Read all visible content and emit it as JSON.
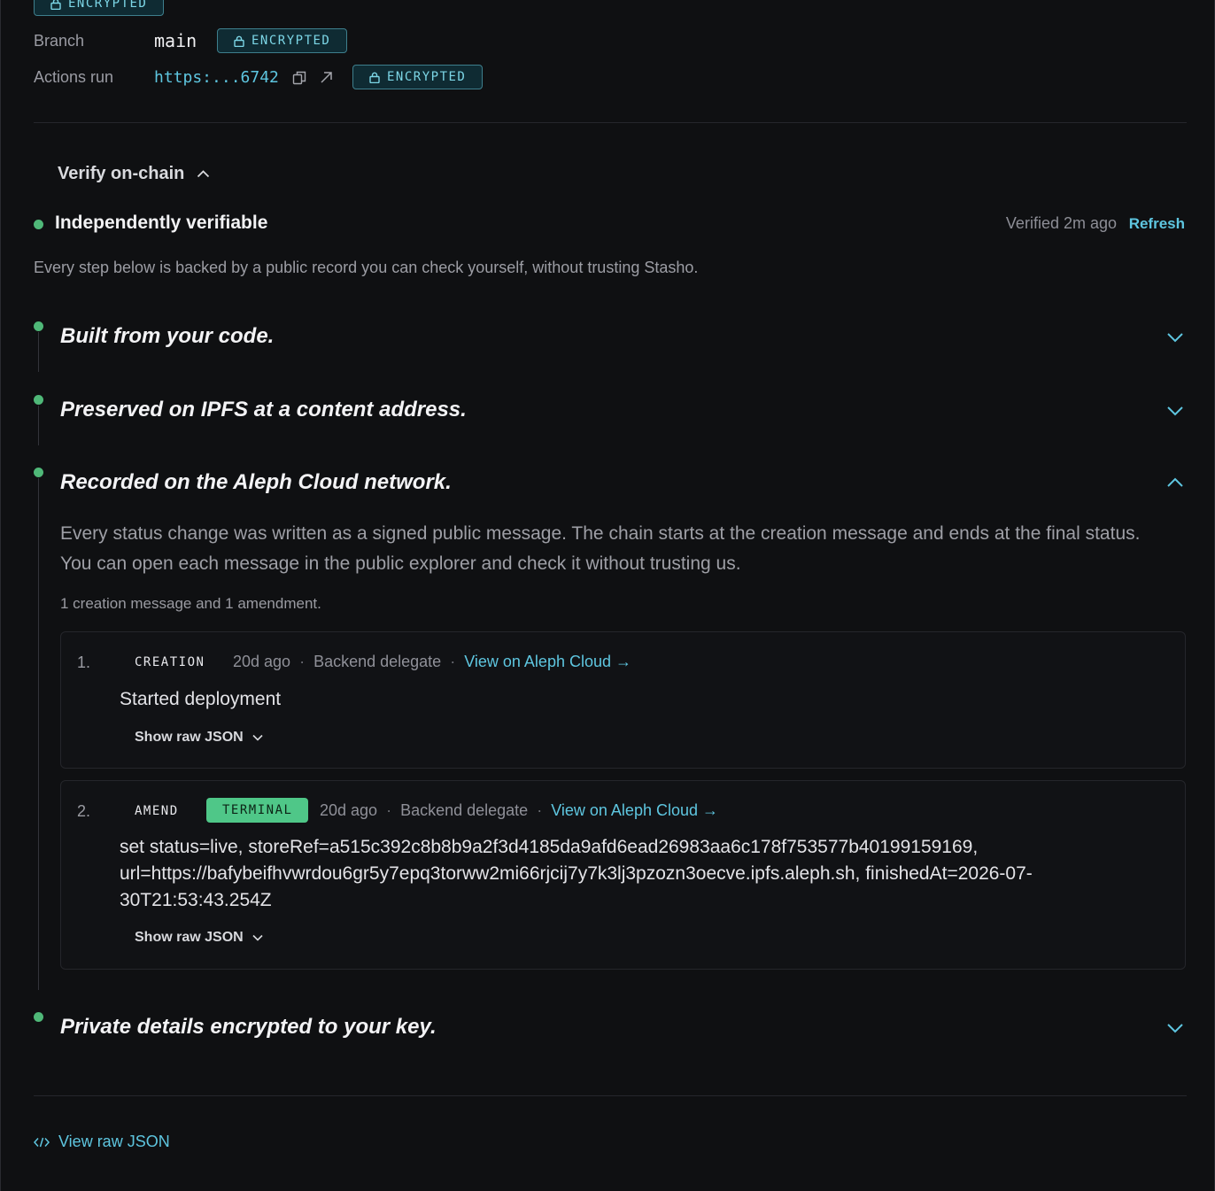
{
  "meta": {
    "encrypted_label": "ENCRYPTED",
    "branch_label": "Branch",
    "branch_value": "main",
    "actions_label": "Actions run",
    "actions_value": "https:...6742"
  },
  "verify": {
    "toggle_label": "Verify on-chain",
    "status_title": "Independently verifiable",
    "verified_ago": "Verified 2m ago",
    "refresh_label": "Refresh",
    "intro": "Every step below is backed by a public record you can check yourself, without trusting Stasho.",
    "steps": [
      {
        "title": "Built from your code."
      },
      {
        "title": "Preserved on IPFS at a content address."
      },
      {
        "title": "Recorded on the Aleph Cloud network.",
        "description": "Every status change was written as a signed public message. The chain starts at the creation message and ends at the final status. You can open each message in the public explorer and check it without trusting us.",
        "count": "1 creation message and 1 amendment.",
        "messages": [
          {
            "num": "1.",
            "kind": "CREATION",
            "age": "20d ago",
            "by": "Backend delegate",
            "link": "View on Aleph Cloud →",
            "body": "Started deployment",
            "raw": "Show raw JSON"
          },
          {
            "num": "2.",
            "kind": "AMEND",
            "badge": "TERMINAL",
            "age": "20d ago",
            "by": "Backend delegate",
            "link": "View on Aleph Cloud →",
            "body": "set status=live, storeRef=a515c392c8b8b9a2f3d4185da9afd6ead26983aa6c178f753577b40199159169, url=https://bafybeifhvwrdou6gr5y7epq3torww2mi66rjcij7y7k3lj3pzozn3oecve.ipfs.aleph.sh, finishedAt=2026-07-30T21:53:43.254Z",
            "raw": "Show raw JSON"
          }
        ]
      },
      {
        "title": "Private details encrypted to your key."
      }
    ]
  },
  "footer": {
    "raw_link": "View raw JSON"
  },
  "colors": {
    "accent": "#5ec6e0",
    "success": "#4fb878",
    "background": "#0f1012"
  }
}
